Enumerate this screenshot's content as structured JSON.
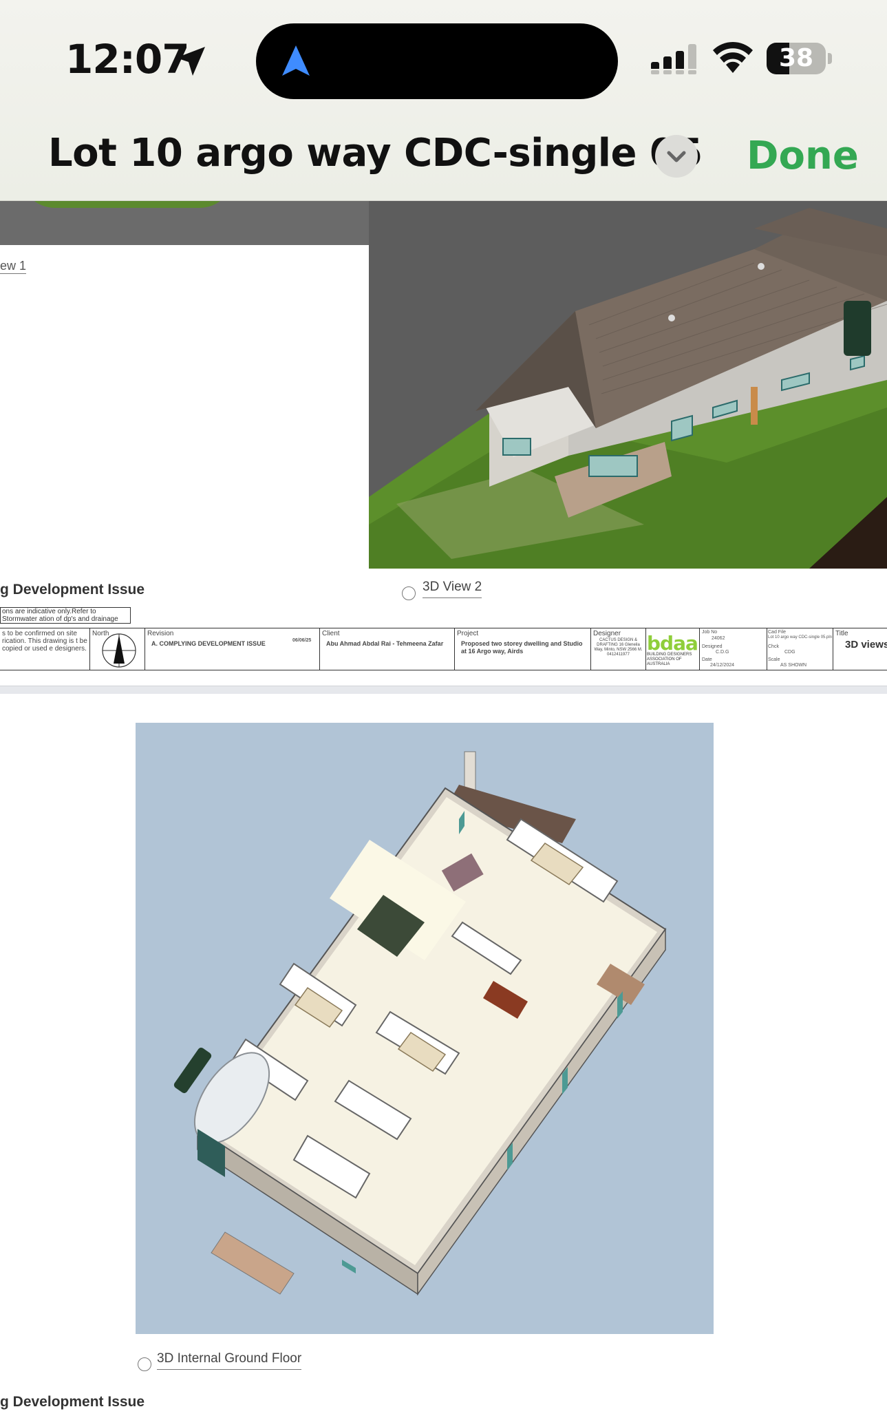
{
  "status_bar": {
    "time": "12:07",
    "battery_level": "38",
    "battery_percent": 38
  },
  "nav": {
    "title": "Lot 10 argo way CDC-single 05",
    "done_label": "Done",
    "accent_color": "#34a853"
  },
  "page1": {
    "view1_caption": "ew 1",
    "view2_caption": "3D View 2",
    "issue_heading": "g Development Issue",
    "note_box": "ons are indicative only.Refer to Stormwater ation of dp's and drainage pies.",
    "note_text": "s to be confirmed on site rication. This drawing is t be copied or used e designers.",
    "title_block": {
      "north_label": "North",
      "revision_label": "Revision",
      "revision_value": "A.    COMPLYING DEVELOPMENT ISSUE",
      "revision_date": "06/06/25",
      "client_label": "Client",
      "client_value": "Abu Ahmad Abdal Rai  - Tehmeena Zafar",
      "project_label": "Project",
      "project_value": "Proposed two storey dwelling and Studio at 16 Argo way, Airds",
      "designer_label": "Designer",
      "designer_value": "CACTUS DESIGN & DRAFTING 16 Gleneila Way, Minto, NSW 2566 M. 0412411977",
      "logo_text": "bdaa",
      "logo_sub": "BUILDING DESIGNERS ASSOCIATION OF AUSTRALIA",
      "job_no_label": "Job No",
      "job_no": "24062",
      "designed_label": "Designed",
      "designed_value": "C.D.G",
      "date_label": "Date",
      "date_value": "24/12/2024",
      "cad_file_label": "Cad File",
      "cad_file_value": "Lot 10 argo way CDC-single 05.pln",
      "check_label": "Chck",
      "check_value": "CDG",
      "scale_label": "Scale",
      "scale_value": "AS SHOWN",
      "title_label": "Title",
      "title_value": "3D views"
    }
  },
  "page2": {
    "caption": "3D Internal Ground Floor",
    "issue_heading": "g Development Issue"
  }
}
